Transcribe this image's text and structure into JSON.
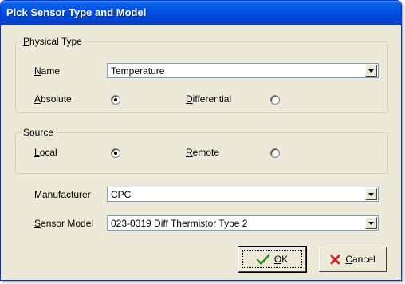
{
  "window": {
    "title": "Pick Sensor Type and Model"
  },
  "physical_type": {
    "legend_prefix": "P",
    "legend_rest": "hysical Type",
    "name_label_prefix": "N",
    "name_label_rest": "ame",
    "name_value": "Temperature",
    "absolute_prefix": "A",
    "absolute_rest": "bsolute",
    "differential_prefix": "D",
    "differential_rest": "ifferential",
    "selected": "Absolute"
  },
  "source": {
    "legend": "Source",
    "local_prefix": "L",
    "local_rest": "ocal",
    "remote_prefix": "R",
    "remote_rest": "emote",
    "selected": "Local"
  },
  "manufacturer": {
    "label_prefix": "M",
    "label_rest": "anufacturer",
    "value": "CPC"
  },
  "sensor_model": {
    "label_prefix": "S",
    "label_rest": "ensor Model",
    "value": "023-0319 Diff Thermistor Type 2"
  },
  "buttons": {
    "ok_prefix": "O",
    "ok_rest": "K",
    "cancel_prefix": "C",
    "cancel_rest": "ancel"
  },
  "colors": {
    "title_bar": "#0054e3",
    "face": "#ece9d8",
    "ok_check": "#2e8b1e",
    "cancel_x": "#c8201b"
  },
  "icons": {
    "ok": "check-icon",
    "cancel": "x-icon",
    "dropdown": "chevron-down-icon"
  }
}
